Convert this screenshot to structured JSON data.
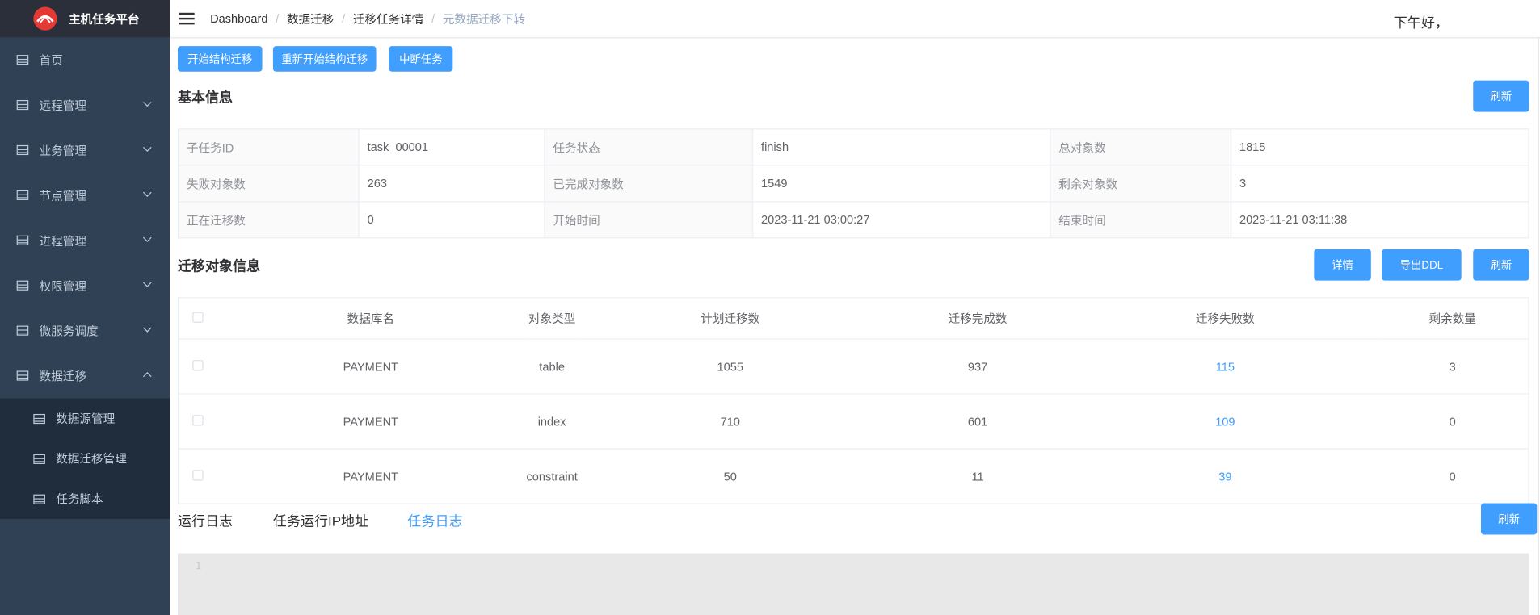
{
  "app": {
    "title": "主机任务平台"
  },
  "sidebar": {
    "items": [
      {
        "label": "首页",
        "expandable": false
      },
      {
        "label": "远程管理",
        "expandable": true
      },
      {
        "label": "业务管理",
        "expandable": true
      },
      {
        "label": "节点管理",
        "expandable": true
      },
      {
        "label": "进程管理",
        "expandable": true
      },
      {
        "label": "权限管理",
        "expandable": true
      },
      {
        "label": "微服务调度",
        "expandable": true
      },
      {
        "label": "数据迁移",
        "expandable": true,
        "expanded": true
      }
    ],
    "subitems": [
      {
        "label": "数据源管理"
      },
      {
        "label": "数据迁移管理"
      },
      {
        "label": "任务脚本"
      }
    ]
  },
  "header": {
    "breadcrumb": [
      "Dashboard",
      "数据迁移",
      "迁移任务详情",
      "元数据迁移下转"
    ],
    "greeting": "下午好，"
  },
  "actions": {
    "start": "开始结构迁移",
    "restart": "重新开始结构迁移",
    "interrupt": "中断任务"
  },
  "basic_info": {
    "title": "基本信息",
    "refresh": "刷新",
    "rows": [
      [
        {
          "label": "子任务ID",
          "value": "task_00001"
        },
        {
          "label": "任务状态",
          "value": "finish"
        },
        {
          "label": "总对象数",
          "value": "1815"
        }
      ],
      [
        {
          "label": "失败对象数",
          "value": "263"
        },
        {
          "label": "已完成对象数",
          "value": "1549"
        },
        {
          "label": "剩余对象数",
          "value": "3"
        }
      ],
      [
        {
          "label": "正在迁移数",
          "value": "0"
        },
        {
          "label": "开始时间",
          "value": "2023-11-21 03:00:27"
        },
        {
          "label": "结束时间",
          "value": "2023-11-21 03:11:38"
        }
      ]
    ]
  },
  "objects": {
    "title": "迁移对象信息",
    "buttons": {
      "detail": "详情",
      "export": "导出DDL",
      "refresh": "刷新"
    },
    "columns": [
      "数据库名",
      "对象类型",
      "计划迁移数",
      "迁移完成数",
      "迁移失败数",
      "剩余数量"
    ],
    "rows": [
      [
        "PAYMENT",
        "table",
        "1055",
        "937",
        "115",
        "3"
      ],
      [
        "PAYMENT",
        "index",
        "710",
        "601",
        "109",
        "0"
      ],
      [
        "PAYMENT",
        "constraint",
        "50",
        "11",
        "39",
        "0"
      ]
    ]
  },
  "logs": {
    "tabs": [
      "运行日志",
      "任务运行IP地址",
      "任务日志"
    ],
    "active_tab": "任务日志",
    "refresh": "刷新",
    "line_number": "1"
  },
  "colors": {
    "primary": "#409eff",
    "sidebar_bg": "#304156",
    "submenu_bg": "#1f2d3d",
    "logo_bar": "#2b2f3a",
    "logo_red": "#e53935"
  },
  "icons": [
    "logo-icon",
    "menu-table-icon",
    "chevron-down-icon",
    "chevron-up-icon",
    "hamburger-icon"
  ]
}
